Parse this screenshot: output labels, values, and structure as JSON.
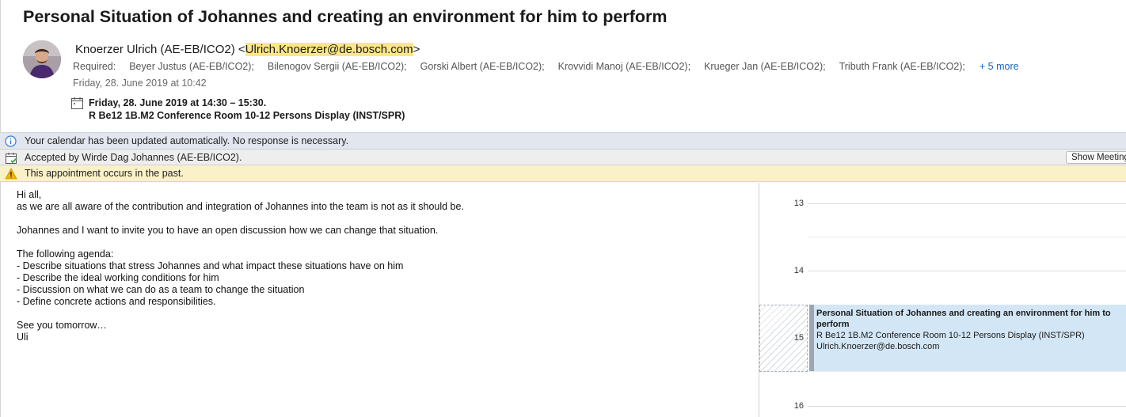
{
  "message": {
    "subject": "Personal Situation of Johannes and creating an environment for him to perform",
    "sender_name": "Knoerzer Ulrich (AE-EB/ICO2) <",
    "sender_email": "Ulrich.Knoerzer@de.bosch.com",
    "sender_close": ">",
    "required_label": "Required:",
    "attendees": [
      "Beyer Justus (AE-EB/ICO2);",
      "Bilenogov Sergii (AE-EB/ICO2);",
      "Gorski Albert (AE-EB/ICO2);",
      "Krovvidi Manoj (AE-EB/ICO2);",
      "Krueger Jan (AE-EB/ICO2);",
      "Tributh Frank (AE-EB/ICO2);"
    ],
    "more_label": "+ 5 more",
    "sent_time": "Friday, 28. June 2019 at 10:42",
    "meeting_when": "Friday, 28. June 2019 at 14:30 – 15:30.",
    "meeting_where": "R Be12 1B.M2 Conference Room 10-12 Persons Display (INST/SPR)"
  },
  "bars": {
    "update_text": "Your calendar has been updated automatically. No response is necessary.",
    "accepted_text": "Accepted by Wirde Dag Johannes (AE-EB/ICO2).",
    "show_meeting_label": "Show Meeting",
    "past_text": "This appointment occurs in the past."
  },
  "body": {
    "lines": [
      "Hi all,",
      "as we are all aware of the contribution and integration of Johannes into the team is not as it should be.",
      "",
      "Johannes and I want to invite you to have an open discussion how we can change that situation.",
      "",
      "The following agenda:",
      "- Describe situations that stress Johannes and what impact these situations have on him",
      "- Describe the ideal working conditions for him",
      "- Discussion on what we can do as a team to change the situation",
      "- Define concrete actions and responsibilities.",
      "",
      "See you tomorrow…",
      "Uli"
    ]
  },
  "calendar": {
    "hours": [
      "13",
      "14",
      "15",
      "16"
    ],
    "event": {
      "title": "Personal Situation of Johannes and creating an environment for him to perform",
      "location": "R Be12 1B.M2 Conference Room 10-12 Persons Display (INST/SPR)",
      "organizer": "Ulrich.Knoerzer@de.bosch.com"
    }
  },
  "colors": {
    "highlight": "#fbe788",
    "link": "#1565c0",
    "event_fill": "#d3e6f6",
    "past_bar": "#fbf1c8"
  }
}
